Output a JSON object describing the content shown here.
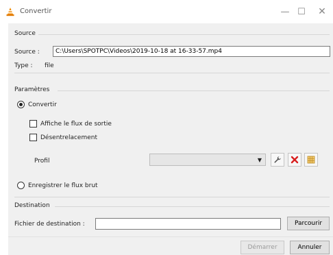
{
  "window": {
    "title": "Convertir",
    "controls": {
      "minimize": "—",
      "maximize": "☐",
      "close": "✕"
    }
  },
  "source_group": {
    "title": "Source",
    "source_label": "Source :",
    "source_value": "C:\\Users\\SPOTPC\\Videos\\2019-10-18 at 16-33-57.mp4",
    "type_label": "Type :",
    "type_value": "file"
  },
  "params_group": {
    "title": "Paramètres",
    "convert_label": "Convertir",
    "show_output_label": "Affiche le flux de sortie",
    "deinterlace_label": "Désentrelacement",
    "profile_label": "Profil",
    "profile_value": "",
    "raw_dump_label": "Enregistrer le flux brut"
  },
  "destination_group": {
    "title": "Destination",
    "file_label": "Fichier de destination :",
    "file_value": "",
    "browse_label": "Parcourir"
  },
  "footer": {
    "start_label": "Démarrer",
    "cancel_label": "Annuler"
  },
  "icons": {
    "app": "vlc-cone-icon",
    "edit_profile": "wrench-icon",
    "delete_profile": "red-x-icon",
    "new_profile": "grid-icon"
  },
  "colors": {
    "vlc_orange": "#f08a00",
    "delete_red": "#d81e1e"
  }
}
